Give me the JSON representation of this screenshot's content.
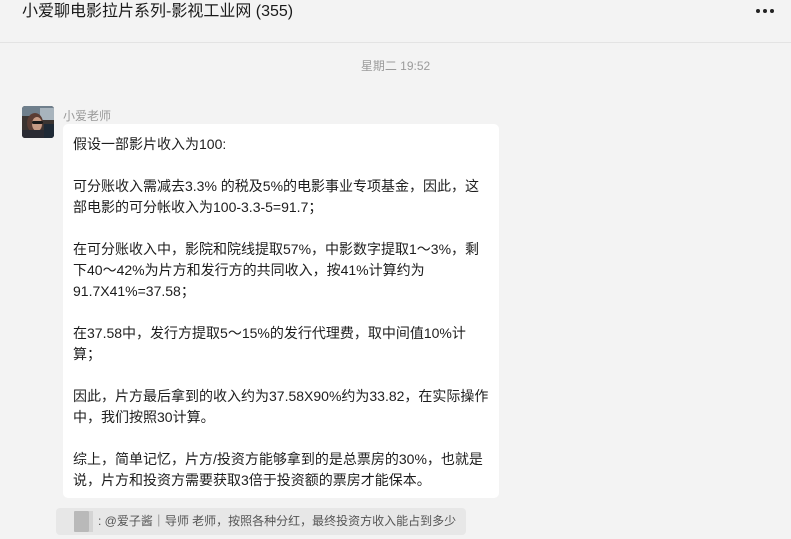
{
  "window": {
    "title": "小爱聊电影拉片系列-影视工业网 (355)"
  },
  "header": {
    "more_icon": "more-horizontal-icon"
  },
  "chat": {
    "timestamp": "星期二 19:52",
    "message": {
      "sender": "小爱老师",
      "avatar_icon": "user-avatar",
      "paragraphs": [
        "假设一部影片收入为100:",
        "可分账收入需减去3.3% 的税及5%的电影事业专项基金，因此，这部电影的可分帐收入为100-3.3-5=91.7；",
        "在可分账收入中，影院和院线提取57%，中影数字提取1～3%，剩下40～42%为片方和发行方的共同收入，按41%计算约为91.7X41%=37.58；",
        "在37.58中，发行方提取5～15%的发行代理费，取中间值10%计算；",
        "因此，片方最后拿到的收入约为37.58X90%约为33.82，在实际操作中，我们按照30计算。",
        "综上，简单记忆，片方/投资方能够拿到的是总票房的30%，也就是说，片方和投资方需要获取3倍于投资额的票房才能保本。"
      ]
    },
    "quote": {
      "text": ": @爱子酱｜导师 老师，按照各种分红，最终投资方收入能占到多少",
      "thumb_icon": "image-thumbnail-icon"
    }
  }
}
